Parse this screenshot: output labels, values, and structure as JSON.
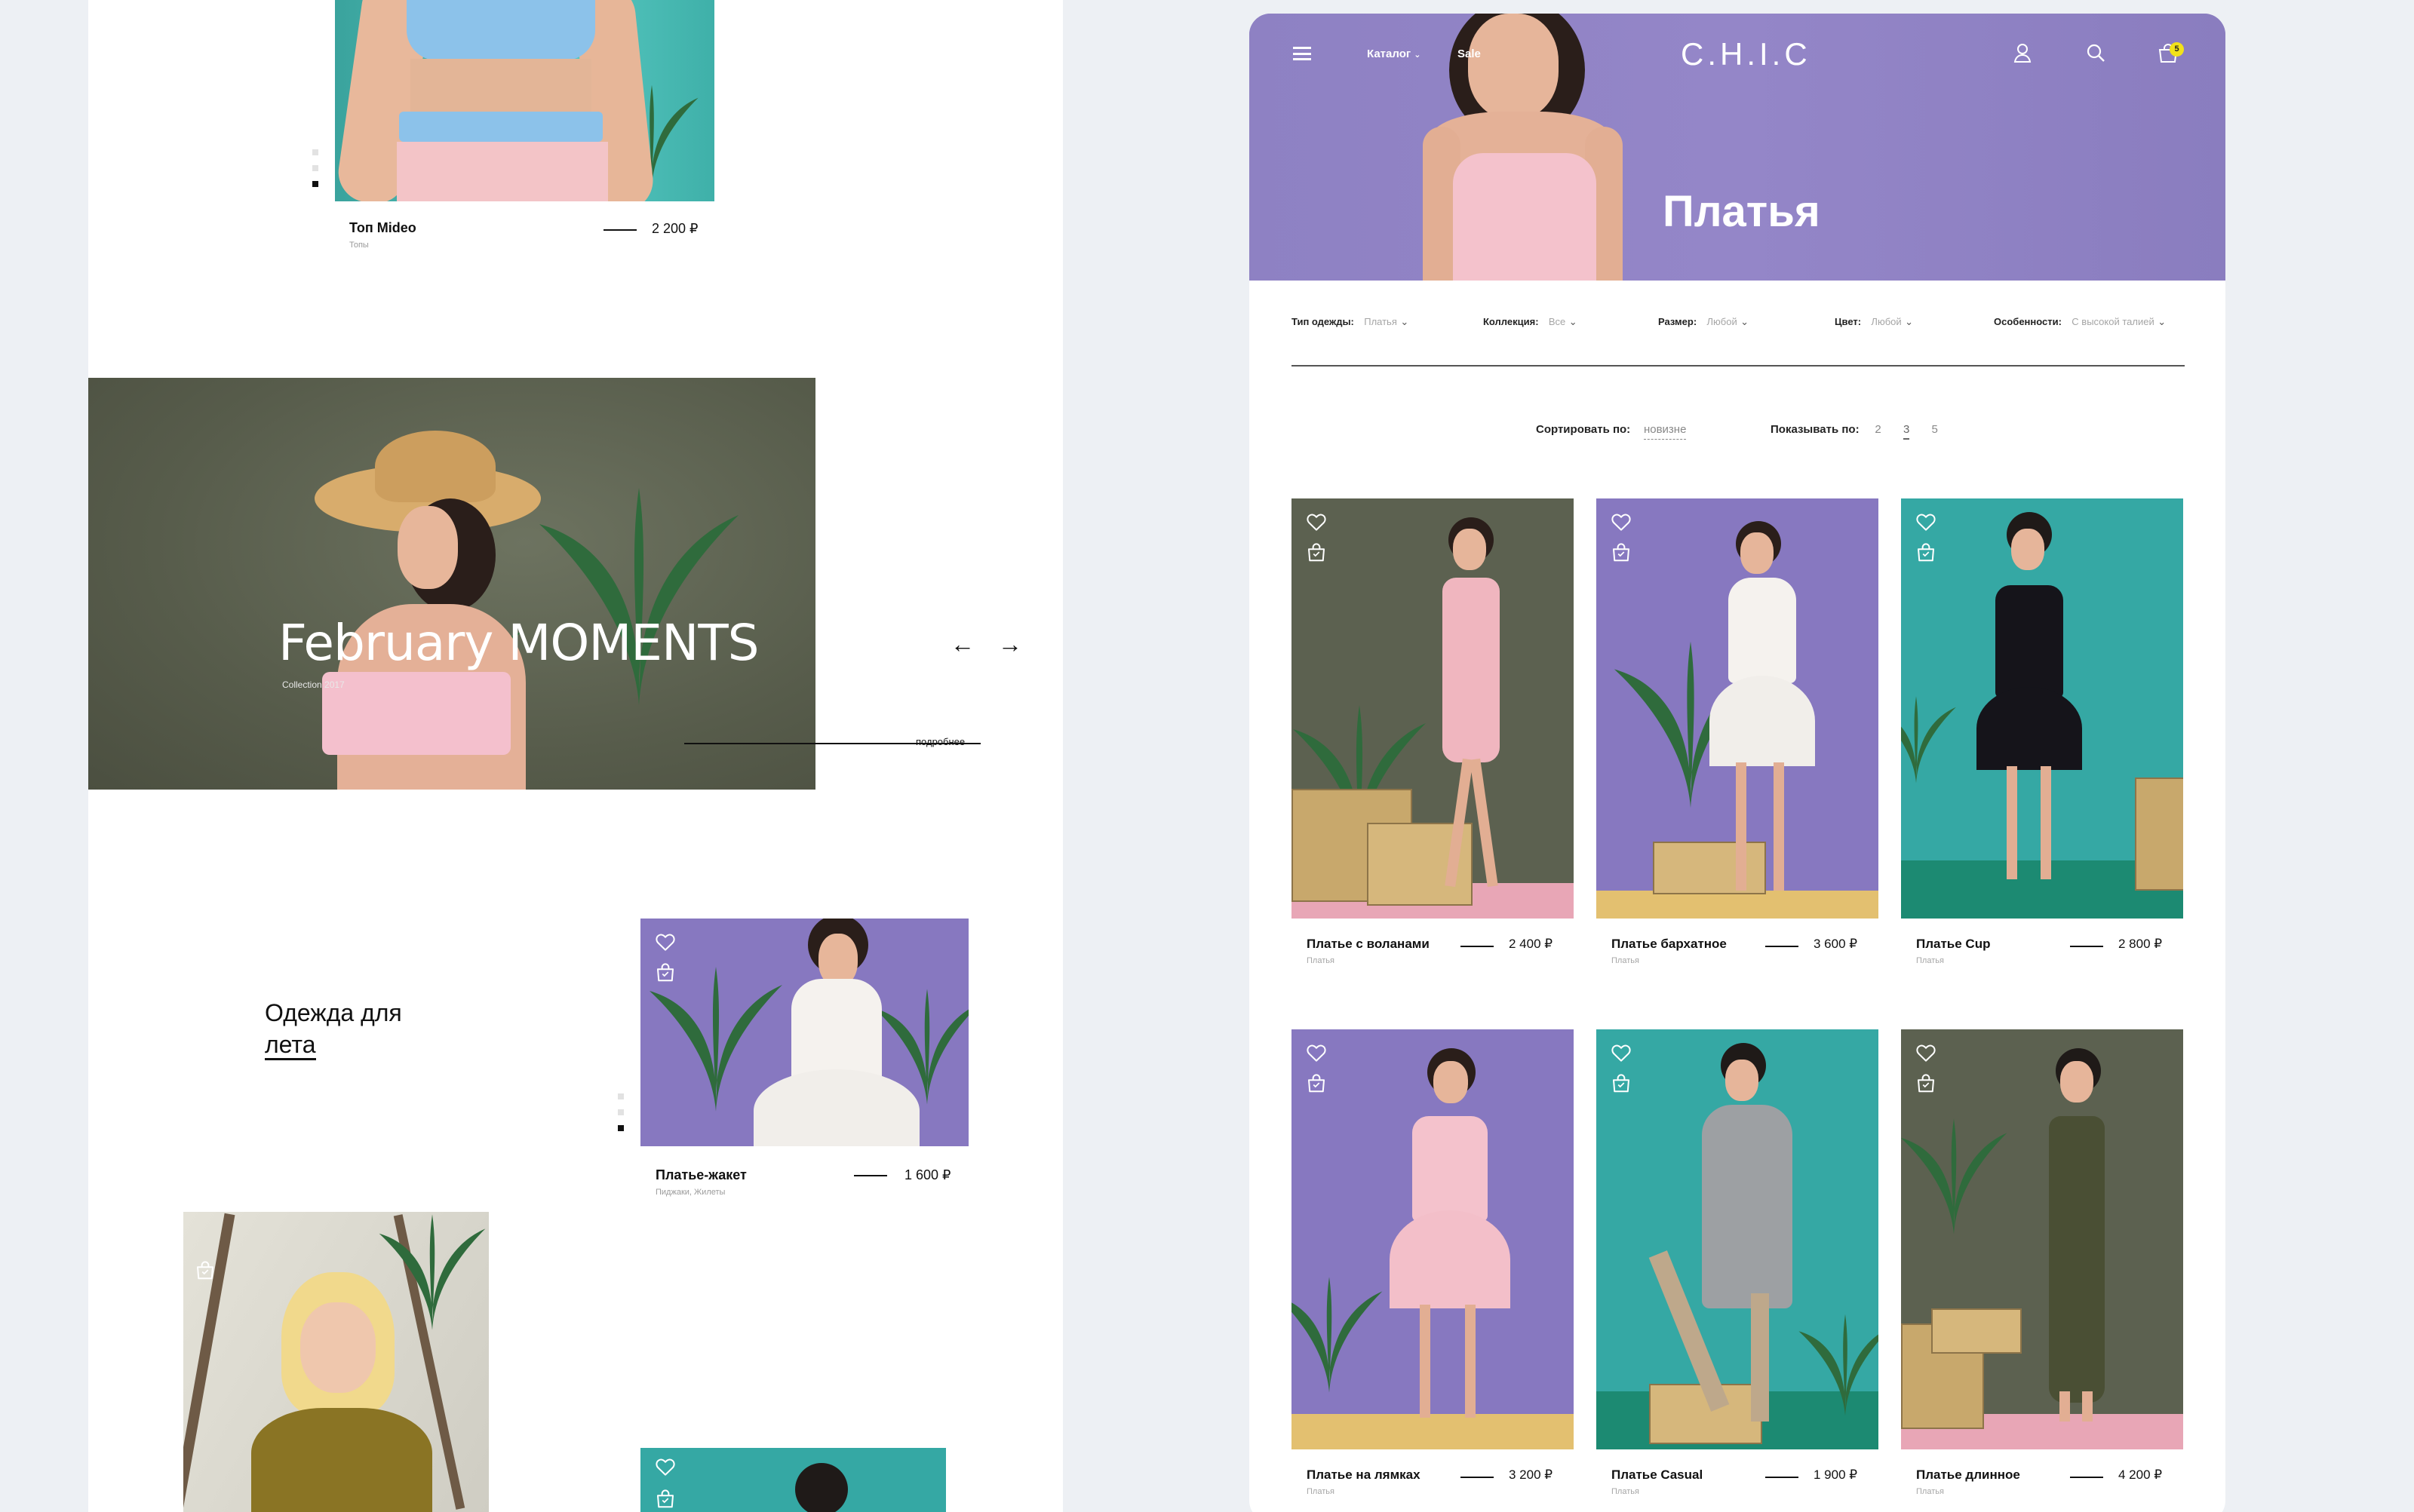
{
  "left": {
    "top_product": {
      "title": "Топ Mideo",
      "category": "Топы",
      "price": "2 200 ₽"
    },
    "banner": {
      "title": "February MOMENTS",
      "subtitle": "Collection 2017",
      "more_link": "подробнее",
      "prev_arrow": "←",
      "next_arrow": "→"
    },
    "section_heading": {
      "line1": "Одежда для",
      "line2": "лета"
    },
    "feature_product": {
      "title": "Платье-жакет",
      "category": "Пиджаки, Жилеты",
      "price": "1 600 ₽"
    }
  },
  "header": {
    "logo": "C.H.I.C",
    "nav": {
      "catalog": "Каталог",
      "sale": "Sale"
    },
    "cart_count": "5",
    "page_title": "Платья"
  },
  "filters": [
    {
      "label": "Тип одежды:",
      "value": "Платья"
    },
    {
      "label": "Коллекция:",
      "value": "Все"
    },
    {
      "label": "Размер:",
      "value": "Любой"
    },
    {
      "label": "Цвет:",
      "value": "Любой"
    },
    {
      "label": "Особенности:",
      "value": "С высокой талией"
    }
  ],
  "sort": {
    "label": "Сортировать по:",
    "value": "новизне"
  },
  "show": {
    "label": "Показывать по:",
    "options": [
      "2",
      "3",
      "5"
    ],
    "selected": "3"
  },
  "products": [
    {
      "title": "Платье с воланами",
      "category": "Платья",
      "price": "2 400 ₽"
    },
    {
      "title": "Платье бархатное",
      "category": "Платья",
      "price": "3 600 ₽"
    },
    {
      "title": "Платье Cup",
      "category": "Платья",
      "price": "2 800 ₽"
    },
    {
      "title": "Платье на лямках",
      "category": "Платья",
      "price": "3 200 ₽"
    },
    {
      "title": "Платье Casual",
      "category": "Платья",
      "price": "1 900 ₽"
    },
    {
      "title": "Платье длинное",
      "category": "Платья",
      "price": "4 200 ₽"
    }
  ],
  "colors": {
    "lavender": "#8f82c2",
    "teal": "#35a8a4",
    "olive": "#5c6150",
    "pink": "#f3b4c2",
    "accent": "#f2e21a"
  }
}
